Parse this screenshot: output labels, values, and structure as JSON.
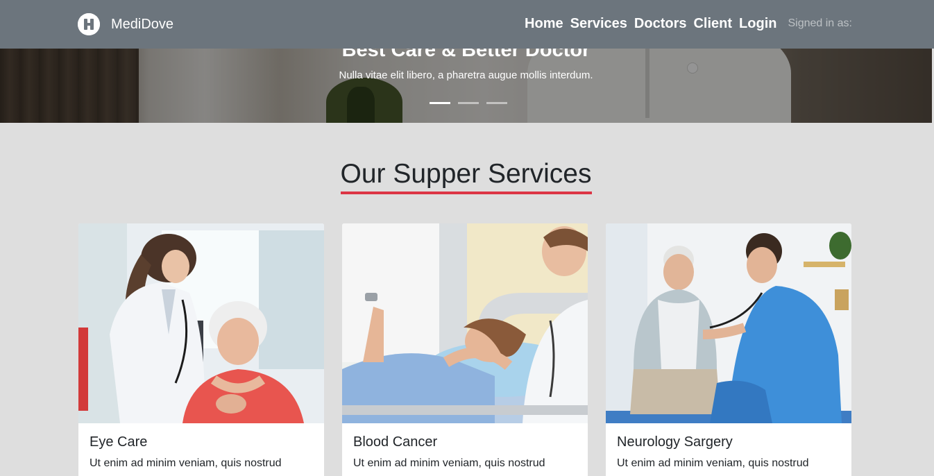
{
  "navbar": {
    "brand_name": "MediDove",
    "brand_logo_letter": "H",
    "links": [
      "Home",
      "Services",
      "Doctors",
      "Client",
      "Login"
    ],
    "signed_in_text": "Signed in as:"
  },
  "hero": {
    "title": "Best Care & Better Doctor",
    "text": "Nulla vitae elit libero, a pharetra augue mollis interdum.",
    "slide_count": 3,
    "active_slide": 1
  },
  "services": {
    "heading": "Our Supper Services",
    "accent_color": "#dc3545",
    "cards": [
      {
        "title": "Eye Care",
        "text": "Ut enim ad minim veniam, quis nostrud"
      },
      {
        "title": "Blood Cancer",
        "text": "Ut enim ad minim veniam, quis nostrud"
      },
      {
        "title": "Neurology Sargery",
        "text": "Ut enim ad minim veniam, quis nostrud"
      }
    ]
  },
  "colors": {
    "navbar": "#6c757d",
    "page_background": "#dedede",
    "heading_underline": "#dc3545"
  }
}
